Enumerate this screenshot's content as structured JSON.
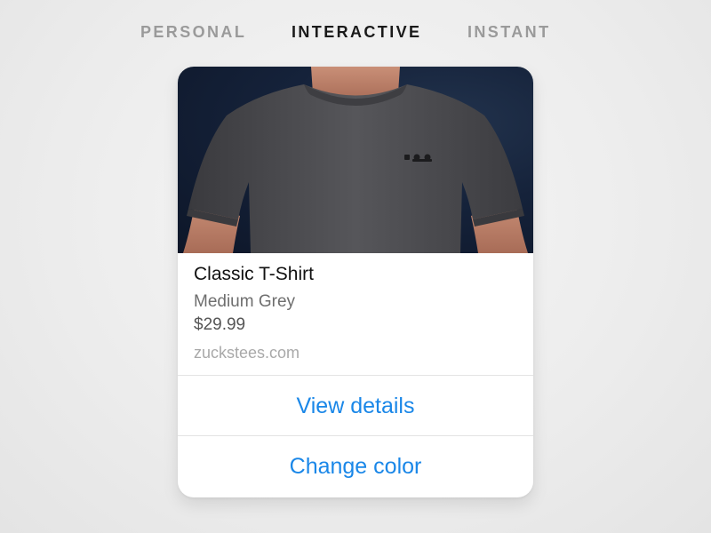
{
  "tabs": [
    {
      "label": "PERSONAL",
      "active": false
    },
    {
      "label": "INTERACTIVE",
      "active": true
    },
    {
      "label": "INSTANT",
      "active": false
    }
  ],
  "product": {
    "image": "grey-t-shirt-photo",
    "title": "Classic T-Shirt",
    "variant": "Medium Grey",
    "price": "$29.99",
    "domain": "zuckstees.com"
  },
  "actions": [
    {
      "label": "View details"
    },
    {
      "label": "Change color"
    }
  ],
  "colors": {
    "accent": "#1a87e8",
    "active_tab": "#1a1a1a",
    "inactive_tab": "#9a9a9a",
    "shirt": "#4a4a4e",
    "photo_background": "#15223a"
  }
}
